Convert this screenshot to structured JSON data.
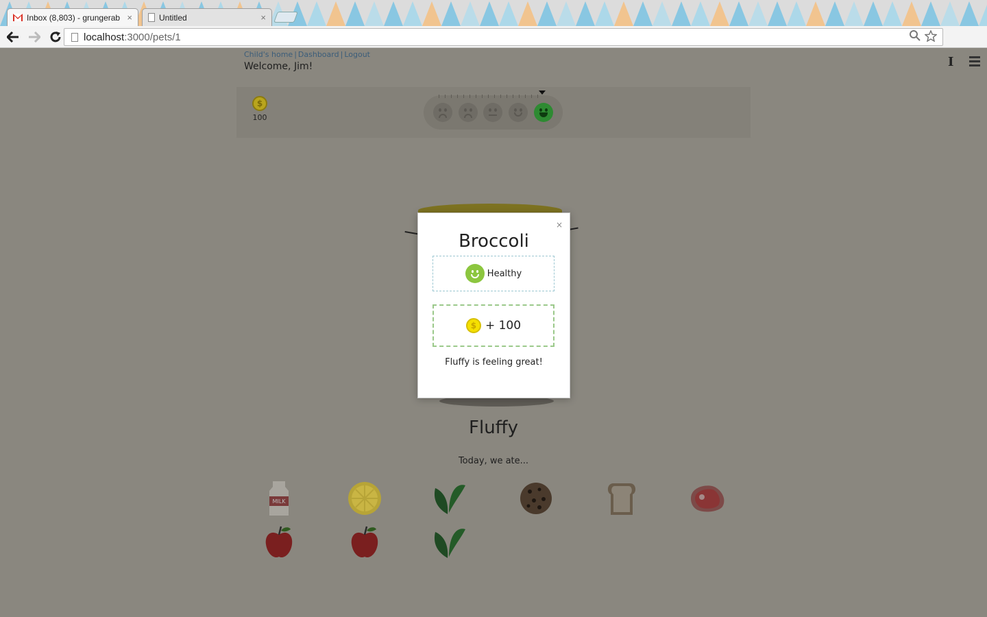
{
  "browser": {
    "tabs": [
      {
        "title": "Inbox (8,803) - grungerab",
        "icon": "gmail-icon",
        "close": "×"
      },
      {
        "title": "Untitled",
        "icon": "document-icon",
        "close": "×"
      }
    ],
    "url_host": "localhost",
    "url_path": ":3000/pets/1"
  },
  "nav": {
    "links": [
      "Child's home",
      "Dashboard",
      "Logout"
    ],
    "separator": "|",
    "welcome": "Welcome, Jim!"
  },
  "status": {
    "coin_symbol": "$",
    "coins": "100",
    "mood_levels": [
      "very-sad",
      "sad",
      "neutral",
      "happy",
      "very-happy"
    ],
    "current_mood_index": 4,
    "colors": {
      "active_mood": "#2e8a32"
    }
  },
  "pet": {
    "name": "Fluffy",
    "ate_label": "Today, we ate..."
  },
  "foods": [
    {
      "name": "milk-icon",
      "label": "MILK"
    },
    {
      "name": "lemon-icon"
    },
    {
      "name": "spinach-icon"
    },
    {
      "name": "cookie-icon"
    },
    {
      "name": "bread-icon"
    },
    {
      "name": "steak-icon"
    },
    {
      "name": "apple-icon"
    },
    {
      "name": "apple-icon"
    },
    {
      "name": "spinach-icon"
    }
  ],
  "modal": {
    "title": "Broccoli",
    "close": "×",
    "health_label": "Healthy",
    "coin_symbol": "$",
    "reward": "+ 100",
    "message": "Fluffy is feeling great!",
    "colors": {
      "health_face": "#8cc63f",
      "coin": "#f5e000"
    }
  }
}
